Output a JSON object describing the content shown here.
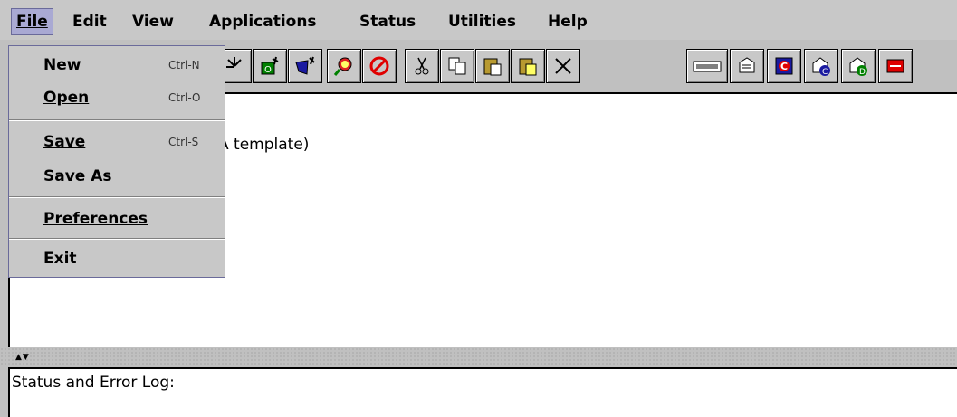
{
  "menubar": {
    "items": [
      {
        "id": "file",
        "label": "File",
        "active": true
      },
      {
        "id": "edit",
        "label": "Edit"
      },
      {
        "id": "view",
        "label": "View"
      },
      {
        "id": "applications",
        "label": "Applications"
      },
      {
        "id": "status",
        "label": "Status"
      },
      {
        "id": "utilities",
        "label": "Utilities"
      },
      {
        "id": "help",
        "label": "Help"
      }
    ]
  },
  "file_menu": {
    "new_label": "New",
    "new_accel": "Ctrl-N",
    "open_label": "Open",
    "open_accel": "Ctrl-O",
    "save_label": "Save",
    "save_accel": "Ctrl-S",
    "saveas_label": "Save As",
    "prefs_label": "Preferences",
    "exit_label": "Exit"
  },
  "toolbar": {
    "icons": [
      "new-icon",
      "open-icon",
      "new-object-icon",
      "new-connection-icon",
      "find-icon",
      "stop-icon",
      "cut-icon",
      "copy-icon",
      "paste-icon",
      "paste-special-icon",
      "delete-icon",
      "form-icon",
      "print-icon",
      "app-c-icon",
      "config-c-icon",
      "config-d-icon",
      "help-stop-icon"
    ]
  },
  "main": {
    "text": "A template)"
  },
  "status": {
    "label": "Status and Error Log:"
  }
}
